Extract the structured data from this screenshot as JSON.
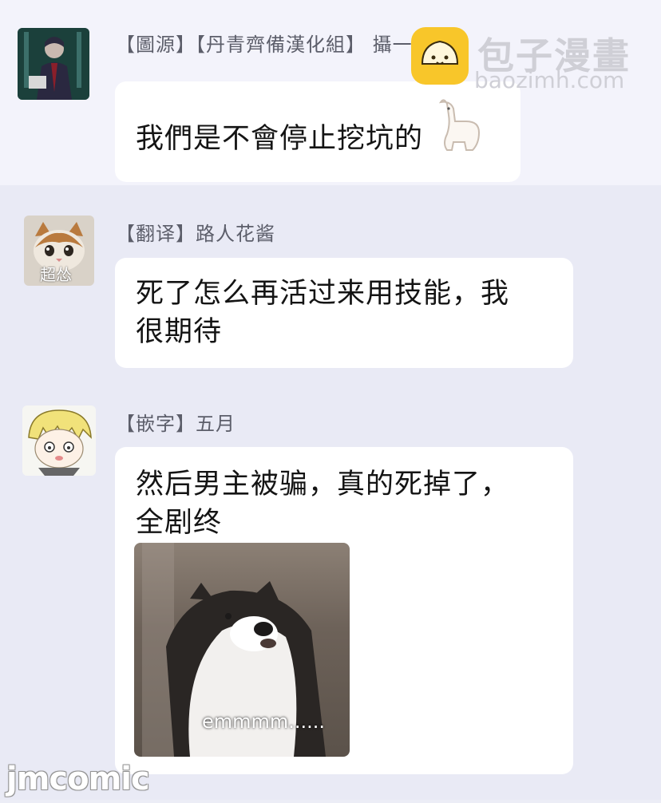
{
  "messages": [
    {
      "sender": "【圖源】【丹青齊備漢化組】 攝一西",
      "text": "我們是不會停止挖坑的",
      "avatar_icon": "anime-character-avatar-icon"
    },
    {
      "sender": "【翻译】路人花酱",
      "text_line1": "死了怎么再活过来用技能，我",
      "text_line2": "很期待",
      "avatar_icon": "cat-avatar-icon",
      "avatar_text": "超怂"
    },
    {
      "sender": "【嵌字】五月",
      "text_line1": "然后男主被骗，真的死掉了，",
      "text_line2": "全剧终",
      "avatar_icon": "anime-blonde-avatar-icon",
      "image_caption": "emmmm......"
    }
  ],
  "watermarks": {
    "site_name": "包子漫畫",
    "site_url": "baozimh.com",
    "corner": "jmcomic"
  },
  "colors": {
    "bubble": "#ffffff",
    "background": "#e9eaf5",
    "logo": "#f8c62a"
  }
}
